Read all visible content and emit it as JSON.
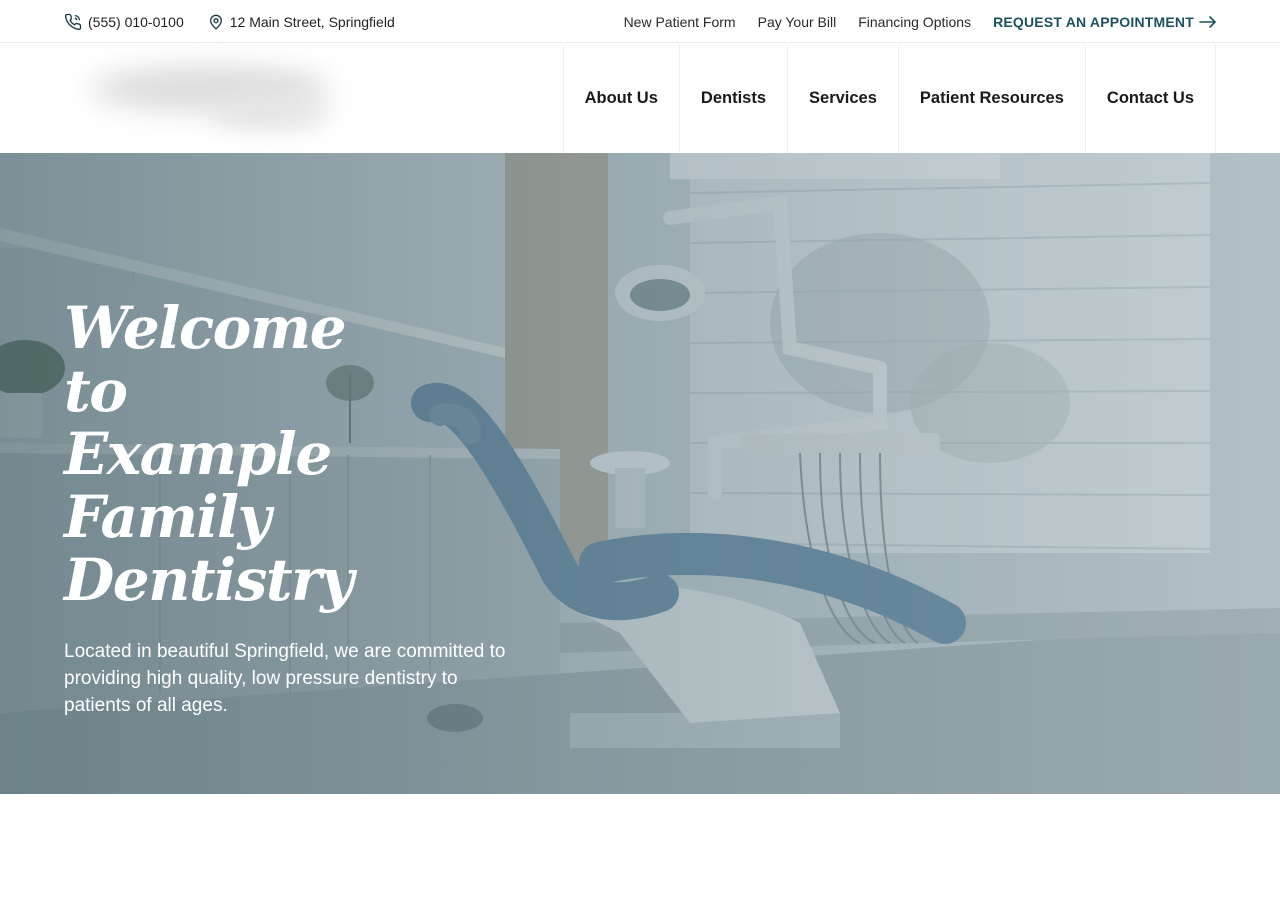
{
  "topbar": {
    "phone": "(555) 010-0100",
    "address": "12 Main Street, Springfield",
    "links": {
      "new_patient_form": "New Patient Form",
      "pay_bill": "Pay Your Bill",
      "financing": "Financing Options"
    },
    "cta": "REQUEST AN APPOINTMENT",
    "icons": {
      "phone": "phone-icon",
      "location": "location-pin-icon",
      "cta": "arrow-right-icon"
    }
  },
  "nav": {
    "items": [
      "About Us",
      "Dentists",
      "Services",
      "Patient Resources",
      "Contact Us"
    ]
  },
  "hero": {
    "title": "Welcome to Example Family Dentistry",
    "description": "Located in beautiful Springfield, we are committed to providing high quality, low pressure dentistry to patients of all ages."
  },
  "colors": {
    "accent": "#1e5160",
    "hero_overlay": "#3a5660"
  }
}
